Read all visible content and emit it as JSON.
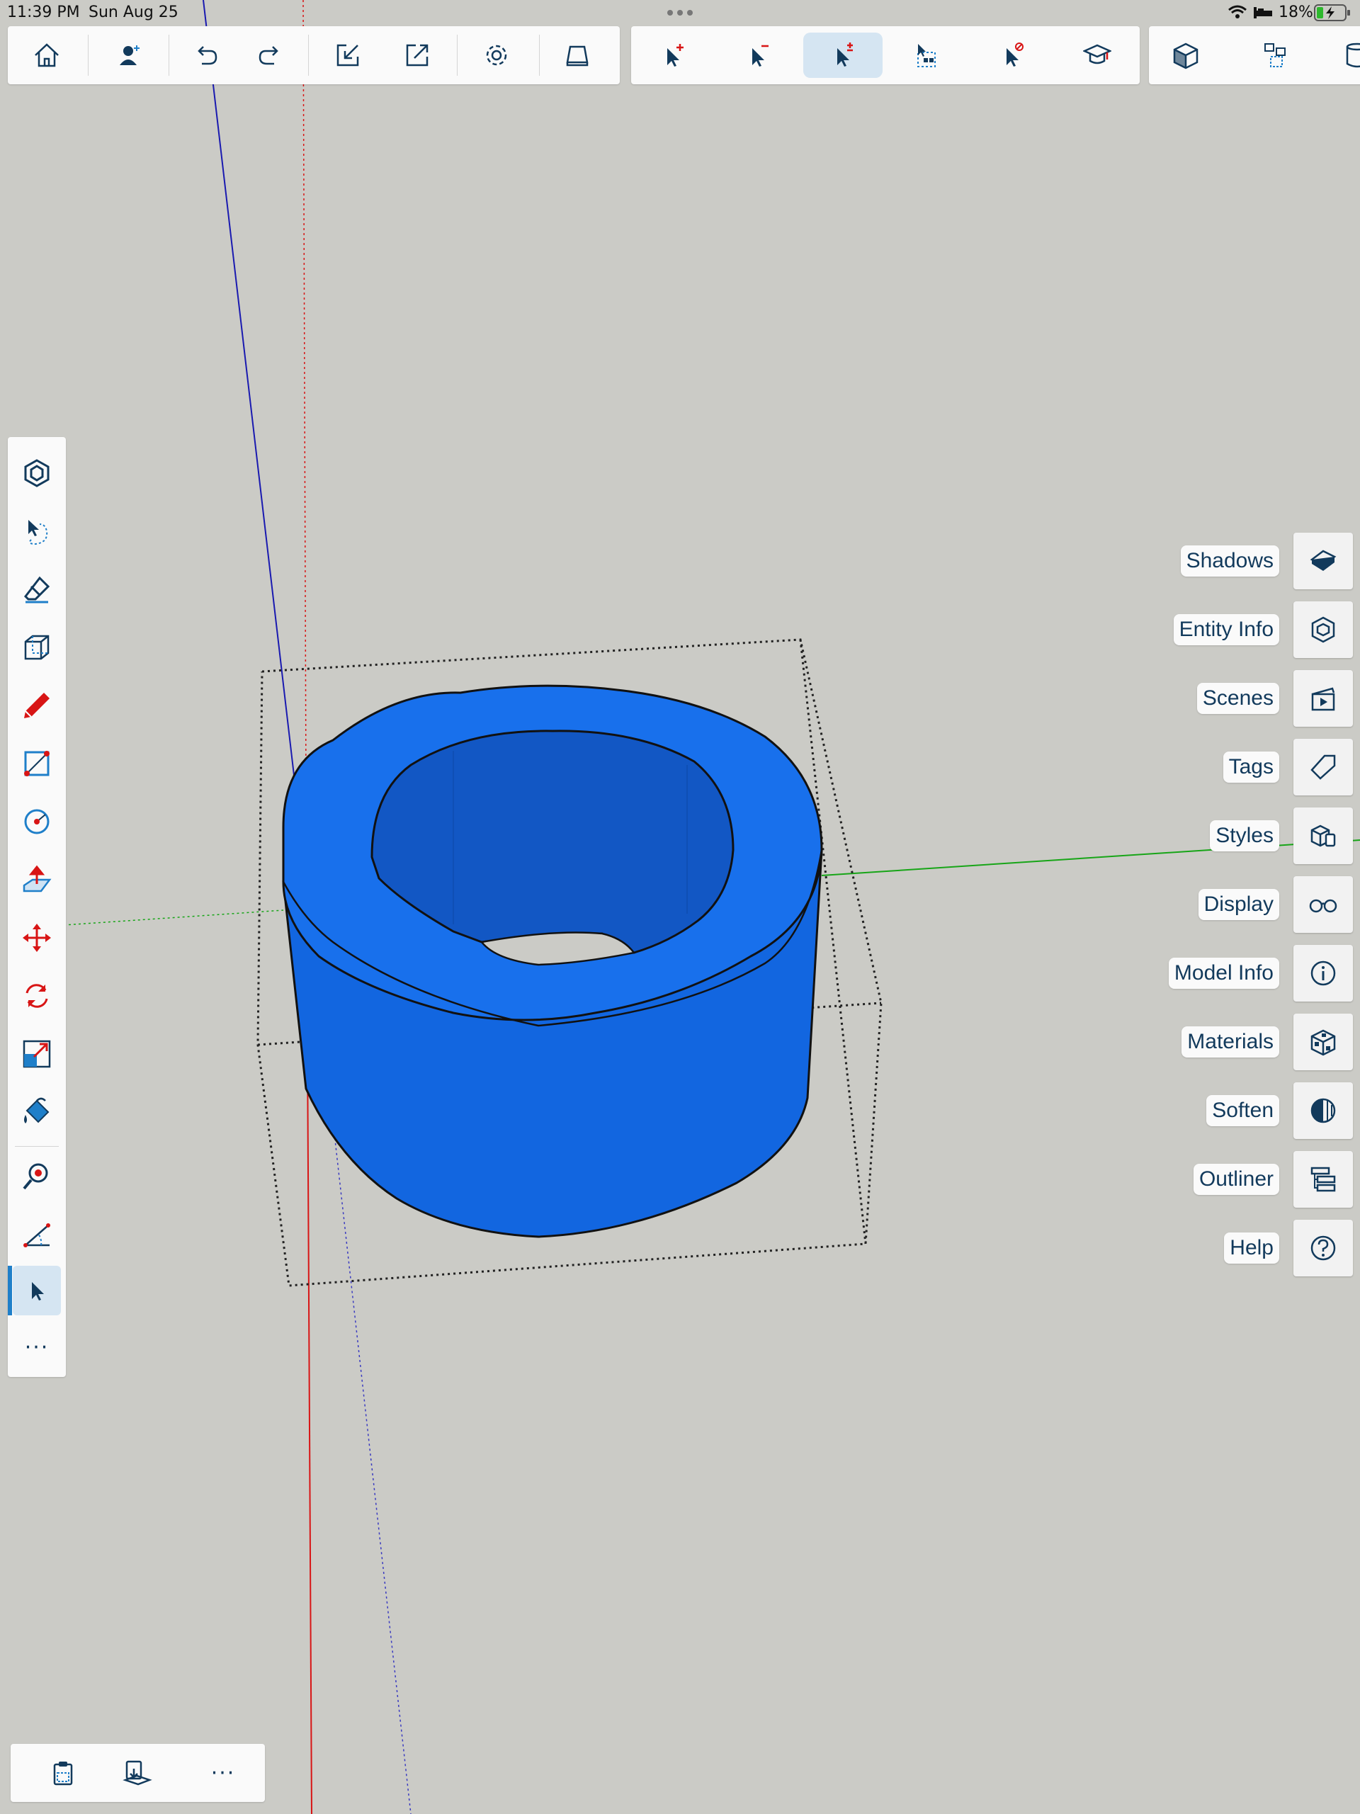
{
  "status_bar": {
    "time": "11:39 PM",
    "date": "Sun Aug 25",
    "battery": "18%"
  },
  "top_toolbar": {
    "left_group": [
      "home-icon",
      "add-user-icon",
      "undo-icon",
      "redo-icon",
      "import-icon",
      "export-icon",
      "gear-icon",
      "view-icon"
    ],
    "selection_group": [
      "select-add-icon",
      "select-subtract-icon",
      "select-toggle-icon",
      "select-box-icon",
      "select-none-icon",
      "instructor-icon"
    ],
    "right_group": [
      "component-icon",
      "components-browser-icon",
      "layers-icon"
    ]
  },
  "left_tools": {
    "more_label": "···"
  },
  "bottom_bar": {
    "more_label": "···"
  },
  "trays": [
    {
      "label": "Shadows",
      "icon": "shadows-icon"
    },
    {
      "label": "Entity Info",
      "icon": "entity-info-icon"
    },
    {
      "label": "Scenes",
      "icon": "scenes-icon"
    },
    {
      "label": "Tags",
      "icon": "tag-icon"
    },
    {
      "label": "Styles",
      "icon": "styles-icon"
    },
    {
      "label": "Display",
      "icon": "glasses-icon"
    },
    {
      "label": "Model Info",
      "icon": "info-icon"
    },
    {
      "label": "Materials",
      "icon": "materials-icon"
    },
    {
      "label": "Soften",
      "icon": "soften-icon"
    },
    {
      "label": "Outliner",
      "icon": "outliner-icon"
    },
    {
      "label": "Help",
      "icon": "help-icon"
    }
  ],
  "colors": {
    "model_fill": "#1569e6",
    "axis_blue": "#1a1ab0",
    "axis_red": "#d81515",
    "axis_green": "#17a517",
    "active_highlight": "#d5e5f2",
    "accent": "#1f7fc9"
  }
}
